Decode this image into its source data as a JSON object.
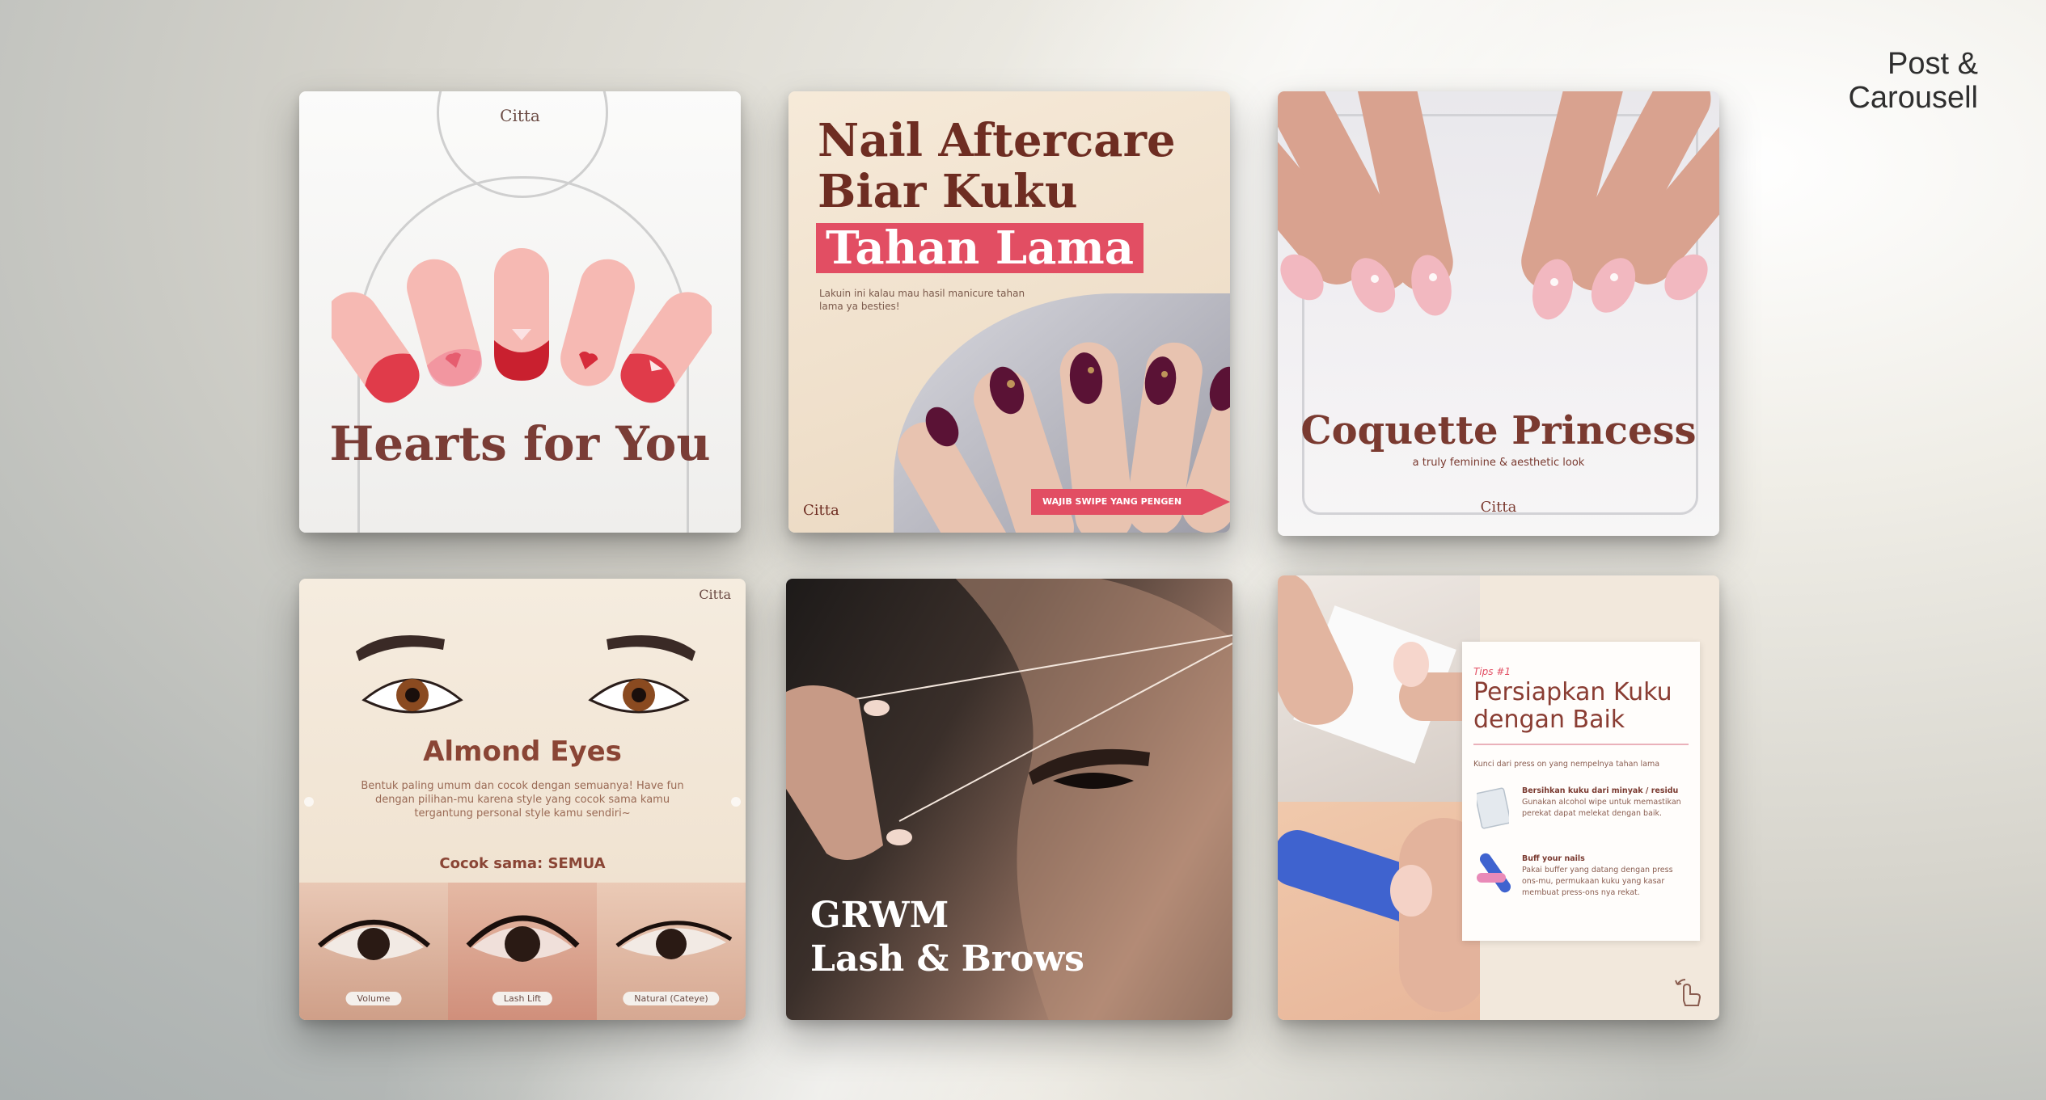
{
  "header": {
    "line1": "Post &",
    "line2": "Carousell"
  },
  "cards": {
    "hearts": {
      "logo": "Citta",
      "title": "Hearts for You"
    },
    "aftercare": {
      "title_line1": "Nail Aftercare",
      "title_line2": "Biar Kuku",
      "title_highlight": "Tahan Lama",
      "subtitle": "Lakuin ini kalau mau hasil manicure tahan lama ya besties!",
      "cta": "WAJIB SWIPE YANG PENGEN TAU",
      "logo": "Citta"
    },
    "coquette": {
      "title": "Coquette Princess",
      "subtitle": "a truly feminine & aesthetic look",
      "logo": "Citta"
    },
    "almond": {
      "logo": "Citta",
      "title": "Almond Eyes",
      "description": "Bentuk paling umum dan cocok dengan semuanya! Have fun dengan pilihan-mu karena style yang cocok sama kamu tergantung personal style kamu sendiri~",
      "match": "Cocok sama: SEMUA",
      "tags": [
        "Volume",
        "Lash Lift",
        "Natural (Cateye)"
      ]
    },
    "grwm": {
      "title_line1": "GRWM",
      "title_line2": "Lash & Brows"
    },
    "tips": {
      "tag": "Tips #1",
      "heading": "Persiapkan Kuku dengan Baik",
      "intro": "Kunci dari press on yang nempelnya tahan lama",
      "item1_title": "Bersihkan kuku dari minyak / residu",
      "item1_body": "Gunakan alcohol wipe untuk memastikan perekat dapat melekat dengan baik.",
      "item2_title": "Buff your nails",
      "item2_body": "Pakai buffer yang datang dengan press ons-mu, permukaan kuku yang kasar membuat press-ons nya rekat."
    }
  },
  "colors": {
    "brand_red": "#e24e63",
    "brand_brown": "#7a3d36"
  }
}
